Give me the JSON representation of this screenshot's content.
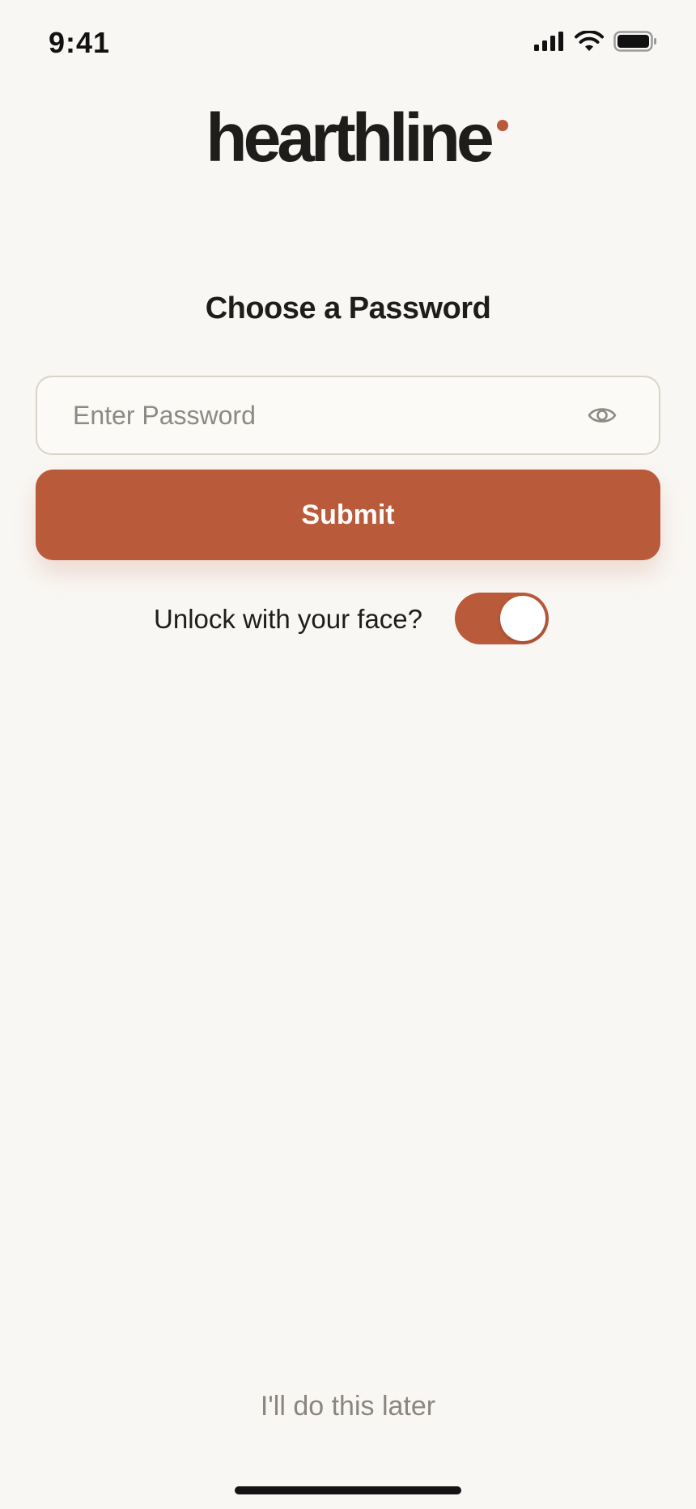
{
  "status_bar": {
    "time": "9:41",
    "signal_icon": "signal-bars-icon",
    "wifi_icon": "wifi-icon",
    "battery_icon": "battery-icon"
  },
  "brand": {
    "name": "hearthline",
    "accent_dot_color": "#b95a3a"
  },
  "form": {
    "title": "Choose a Password",
    "password": {
      "value": "",
      "placeholder": "Enter Password",
      "visibility_icon": "eye-icon"
    },
    "submit_label": "Submit",
    "face_unlock": {
      "label": "Unlock with your face?",
      "enabled": true
    }
  },
  "footer": {
    "later_label": "I'll do this later"
  },
  "colors": {
    "accent": "#b95a3a",
    "background": "#f9f7f4",
    "text": "#1f1d1b",
    "muted_text": "#8a867e",
    "field_border": "#d9d4c6"
  }
}
